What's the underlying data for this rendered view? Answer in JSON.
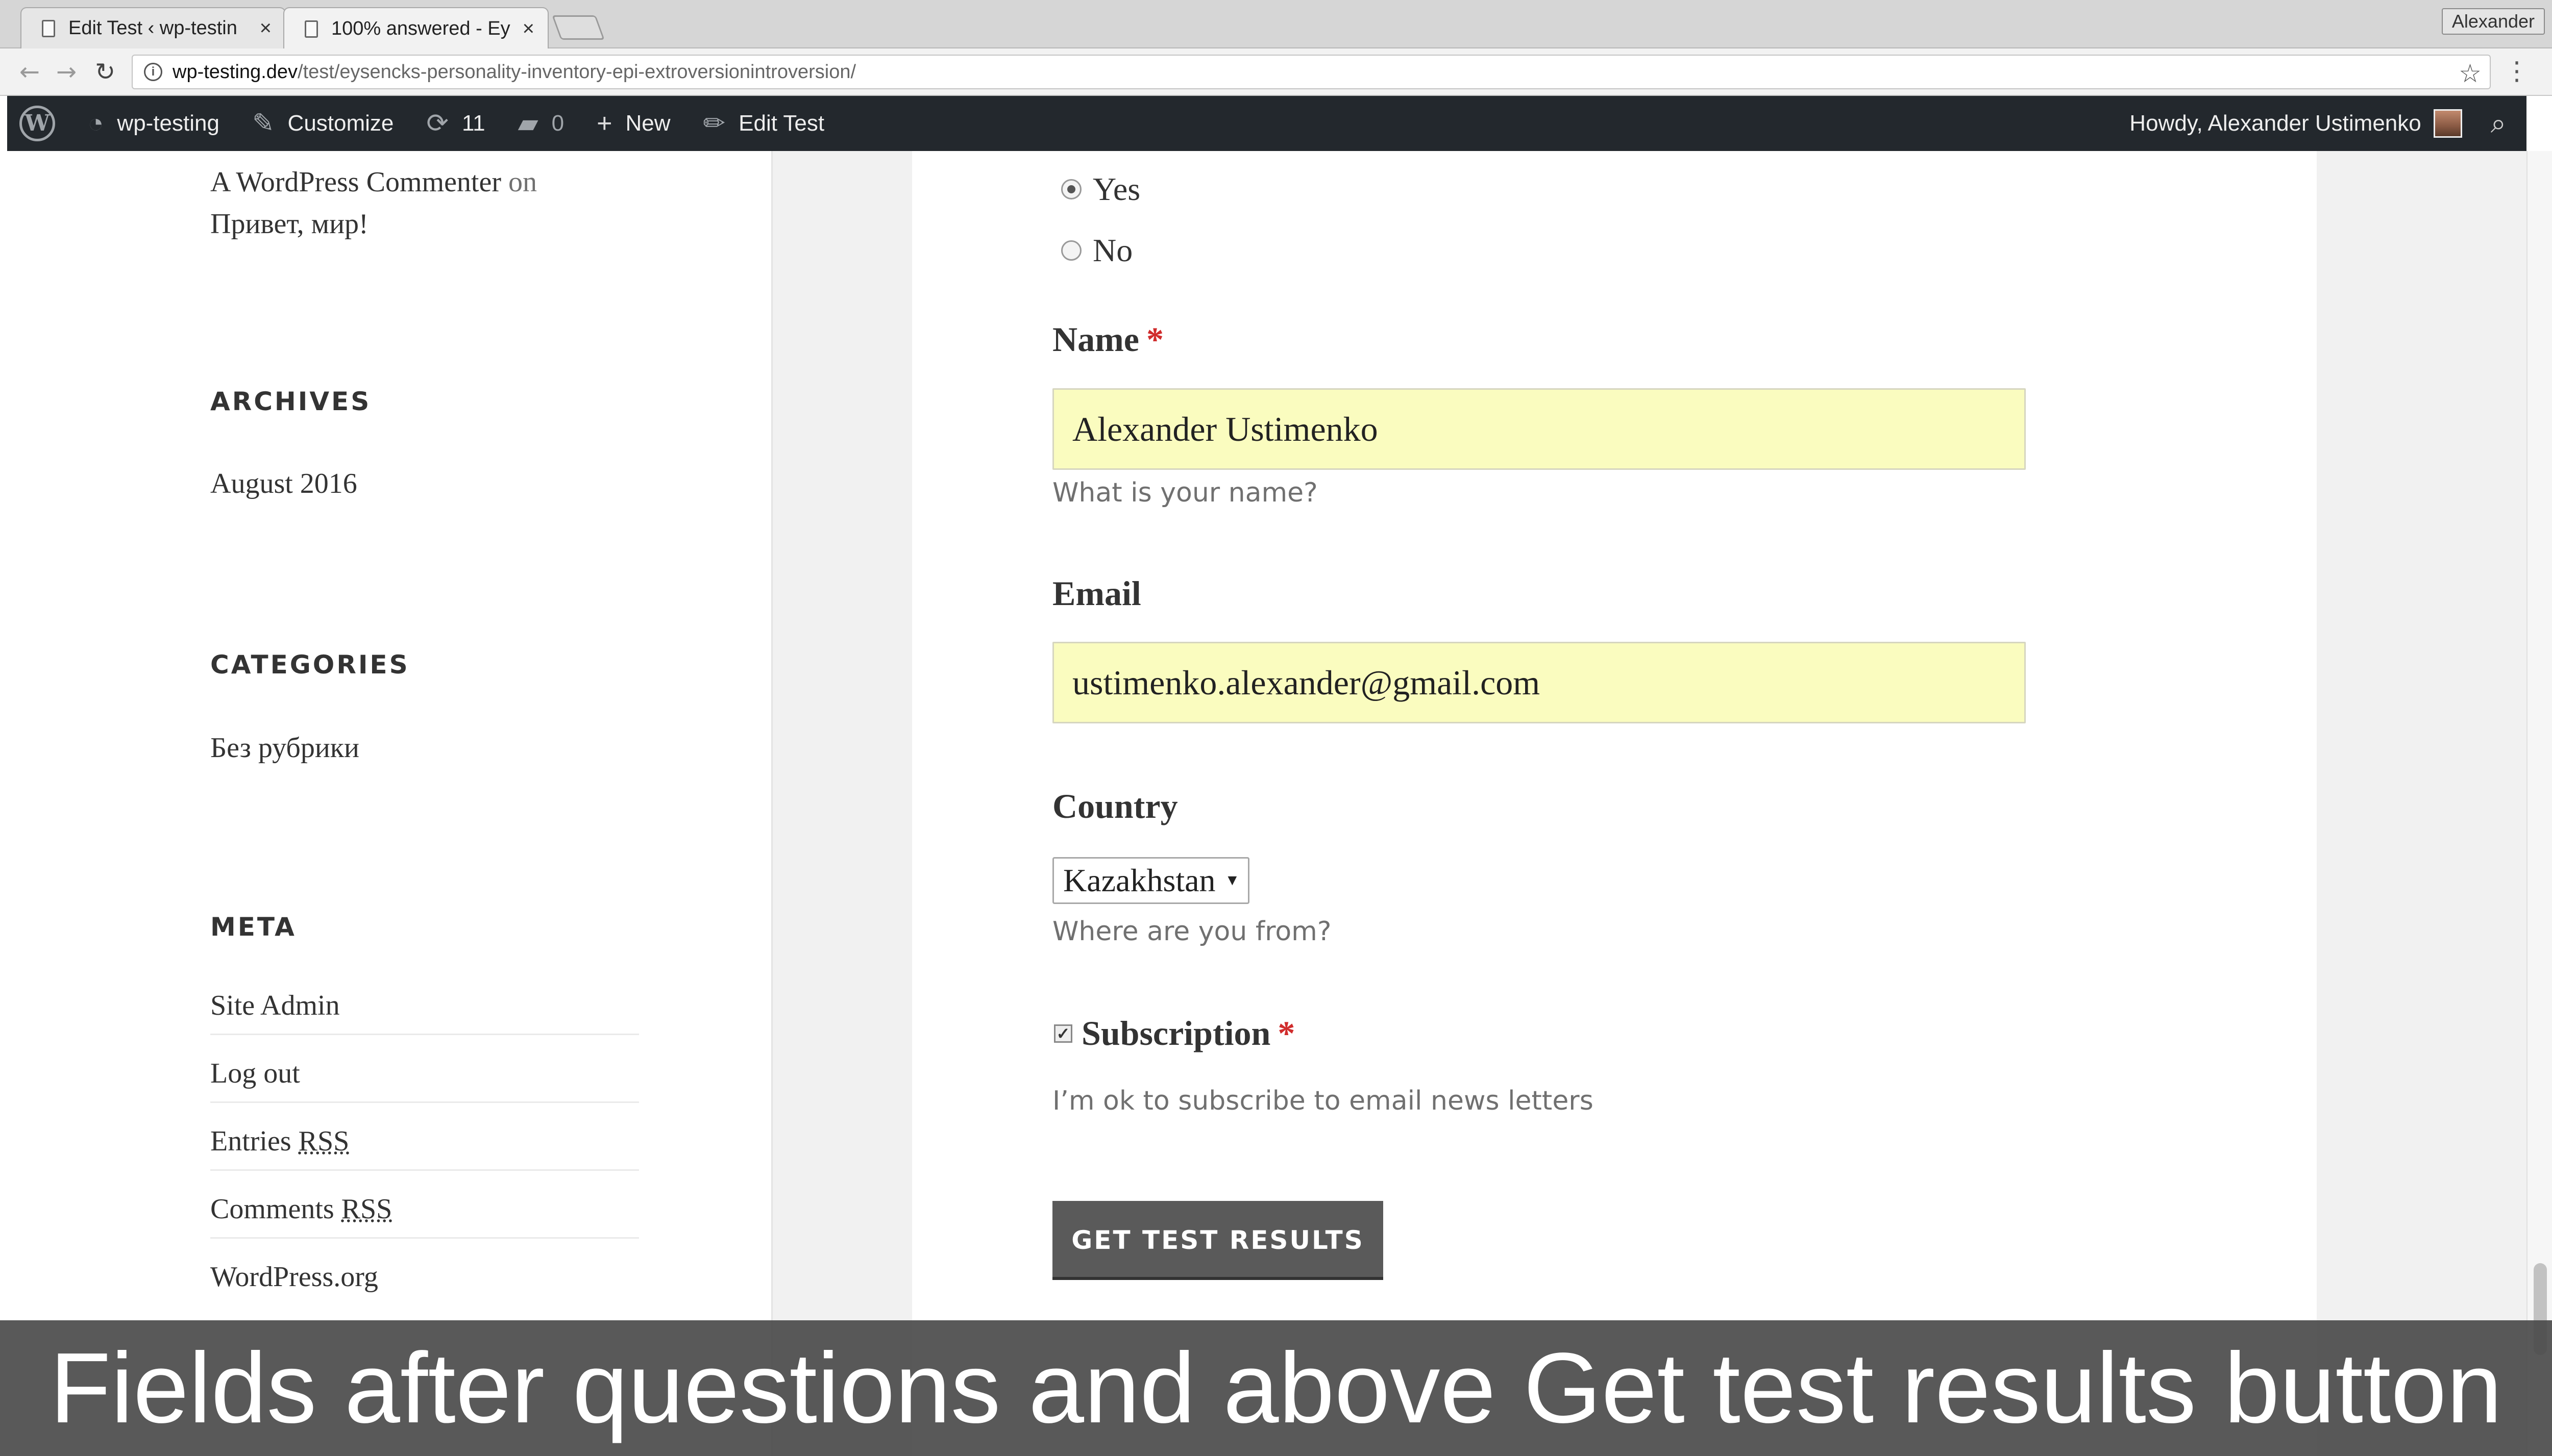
{
  "browser": {
    "tabs": [
      {
        "title": "Edit Test ‹ wp-testin",
        "close": "×"
      },
      {
        "title": "100% answered - Ey",
        "close": "×"
      }
    ],
    "profile": "Alexander",
    "url_host": "wp-testing.dev",
    "url_path": "/test/eysencks-personality-inventory-epi-extroversionintroversion/"
  },
  "adminbar": {
    "site": "wp-testing",
    "customize": "Customize",
    "updates_count": "11",
    "comments_count": "0",
    "new": "New",
    "edit": "Edit Test",
    "howdy": "Howdy, Alexander Ustimenko"
  },
  "sidebar": {
    "recent_comment": {
      "author": "A WordPress Commenter",
      "on": "on",
      "post": "Привет, мир!"
    },
    "archives": {
      "title": "ARCHIVES",
      "items": [
        "August 2016"
      ]
    },
    "categories": {
      "title": "CATEGORIES",
      "items": [
        "Без рубрики"
      ]
    },
    "meta": {
      "title": "META",
      "items": [
        {
          "text": "Site Admin"
        },
        {
          "text": "Log out"
        },
        {
          "prefix": "Entries ",
          "abbr": "RSS"
        },
        {
          "prefix": "Comments ",
          "abbr": "RSS"
        },
        {
          "text": "WordPress.org"
        }
      ]
    }
  },
  "form": {
    "answers": [
      {
        "label": "Yes",
        "checked": true
      },
      {
        "label": "No",
        "checked": false
      }
    ],
    "name": {
      "label": "Name",
      "required": "*",
      "value": "Alexander Ustimenko",
      "description": "What is your name?"
    },
    "email": {
      "label": "Email",
      "value": "ustimenko.alexander@gmail.com"
    },
    "country": {
      "label": "Country",
      "value": "Kazakhstan",
      "description": "Where are you from?"
    },
    "subscription": {
      "label": "Subscription",
      "required": "*",
      "checked": true,
      "description": "I’m ok to subscribe to email news letters"
    },
    "submit": "GET TEST RESULTS"
  },
  "caption": "Fields after questions and above Get test results button"
}
